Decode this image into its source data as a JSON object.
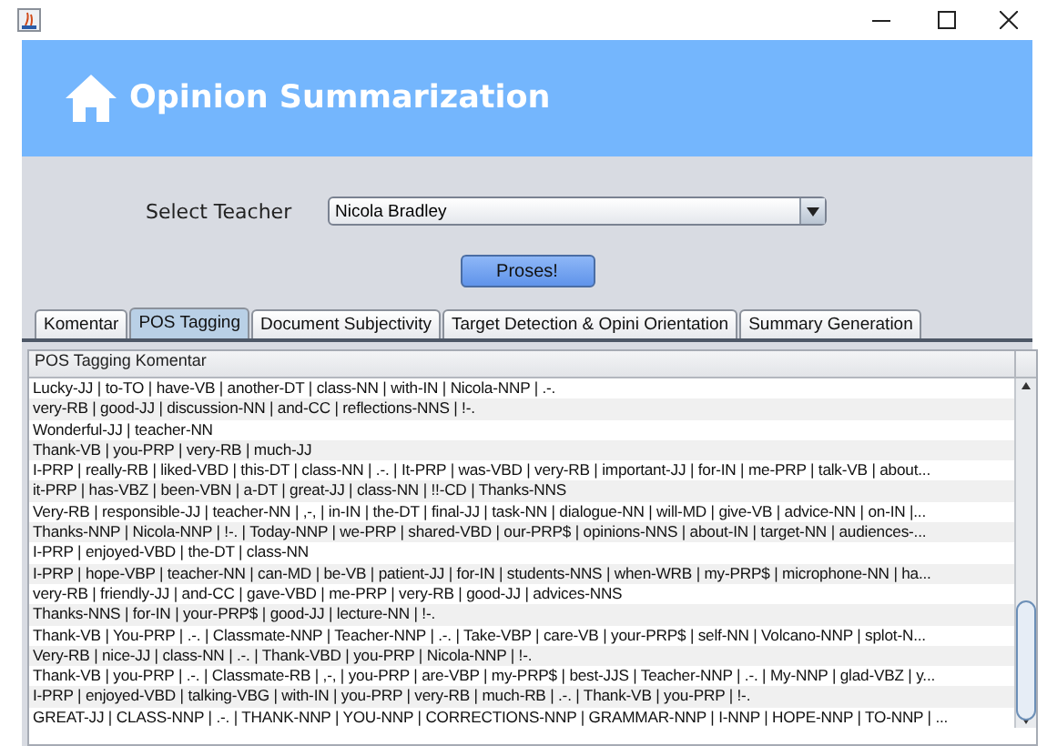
{
  "header": {
    "title": "Opinion Summarization"
  },
  "form": {
    "label": "Select Teacher",
    "teacher": "Nicola Bradley",
    "button": "Proses!"
  },
  "tabs": [
    {
      "label": "Komentar",
      "selected": false
    },
    {
      "label": "POS Tagging",
      "selected": true
    },
    {
      "label": "Document Subjectivity",
      "selected": false
    },
    {
      "label": "Target Detection & Opini Orientation",
      "selected": false
    },
    {
      "label": "Summary Generation",
      "selected": false
    }
  ],
  "table": {
    "columns": [
      "POS Tagging Komentar"
    ],
    "rows": [
      "Lucky-JJ | to-TO | have-VB | another-DT | class-NN | with-IN | Nicola-NNP | .-.",
      "very-RB | good-JJ | discussion-NN | and-CC | reflections-NNS | !-.",
      "Wonderful-JJ | teacher-NN",
      "Thank-VB | you-PRP | very-RB | much-JJ",
      "I-PRP | really-RB | liked-VBD | this-DT | class-NN | .-. | It-PRP | was-VBD | very-RB | important-JJ | for-IN | me-PRP | talk-VB | about...",
      "it-PRP | has-VBZ | been-VBN | a-DT | great-JJ | class-NN | !!-CD | Thanks-NNS",
      "Very-RB | responsible-JJ | teacher-NN | ,-, | in-IN | the-DT | final-JJ | task-NN | dialogue-NN | will-MD | give-VB | advice-NN | on-IN |...",
      "Thanks-NNP | Nicola-NNP | !-. | Today-NNP | we-PRP | shared-VBD | our-PRP$ | opinions-NNS | about-IN | target-NN | audiences-...",
      "I-PRP | enjoyed-VBD | the-DT | class-NN",
      "I-PRP | hope-VBP | teacher-NN | can-MD | be-VB | patient-JJ | for-IN | students-NNS | when-WRB | my-PRP$ | microphone-NN | ha...",
      "very-RB | friendly-JJ | and-CC | gave-VBD | me-PRP | very-RB | good-JJ | advices-NNS",
      "Thanks-NNS | for-IN | your-PRP$ | good-JJ | lecture-NN | !-.",
      "Thank-VB | You-PRP | .-. | Classmate-NNP | Teacher-NNP | .-. | Take-VBP | care-VB | your-PRP$ | self-NN | Volcano-NNP | splot-N...",
      "Very-RB | nice-JJ | class-NN | .-. | Thank-VBD | you-PRP | Nicola-NNP | !-.",
      "Thank-VB | you-PRP | .-. | Classmate-RB | ,-, | you-PRP | are-VBP | my-PRP$ | best-JJS | Teacher-NNP | .-. | My-NNP | glad-VBZ | y...",
      "I-PRP | enjoyed-VBD | talking-VBG | with-IN | you-PRP | very-RB | much-RB | .-. | Thank-VB | you-PRP | !-.",
      "GREAT-JJ | CLASS-NNP | .-. | THANK-NNP | YOU-NNP | CORRECTIONS-NNP | GRAMMAR-NNP | I-NNP | HOPE-NNP | TO-NNP | ..."
    ]
  }
}
